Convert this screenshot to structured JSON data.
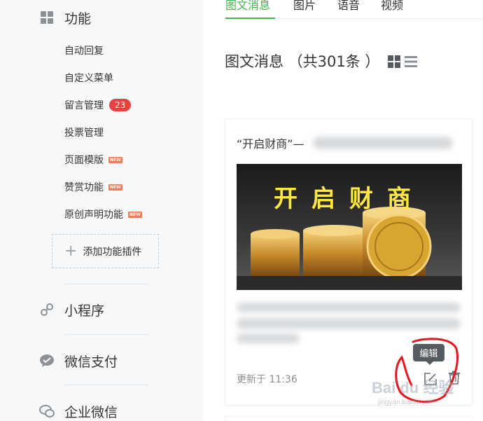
{
  "sidebar": {
    "features_heading": "功能",
    "items": [
      {
        "label": "自动回复"
      },
      {
        "label": "自定义菜单"
      },
      {
        "label": "留言管理",
        "badge": "23"
      },
      {
        "label": "投票管理"
      },
      {
        "label": "页面模版",
        "new": "NEW"
      },
      {
        "label": "赞赏功能",
        "new": "NEW"
      },
      {
        "label": "原创声明功能",
        "new": "NEW"
      }
    ],
    "add_plugin": "添加功能插件",
    "mini_program": "小程序",
    "wechat_pay": "微信支付",
    "enterprise_wechat": "企业微信"
  },
  "tabs": [
    "图文消息",
    "图片",
    "语音",
    "视频"
  ],
  "active_tab": "图文消息",
  "main": {
    "title": "图文消息 （共301条 ）",
    "view_modes": [
      "grid-icon",
      "list-icon"
    ]
  },
  "card": {
    "title": "“开启财商”—",
    "cover_text": "开启财商",
    "updated": "更新于 11:36",
    "tooltip": "编辑"
  },
  "watermark": {
    "brand": "Bai du 经验",
    "url": "jingyan.baidu.com"
  },
  "colors": {
    "accent_green": "#44b549",
    "badge_red": "#e64340",
    "new_tag": "#f47b52",
    "annotation_red": "#e8141e"
  }
}
